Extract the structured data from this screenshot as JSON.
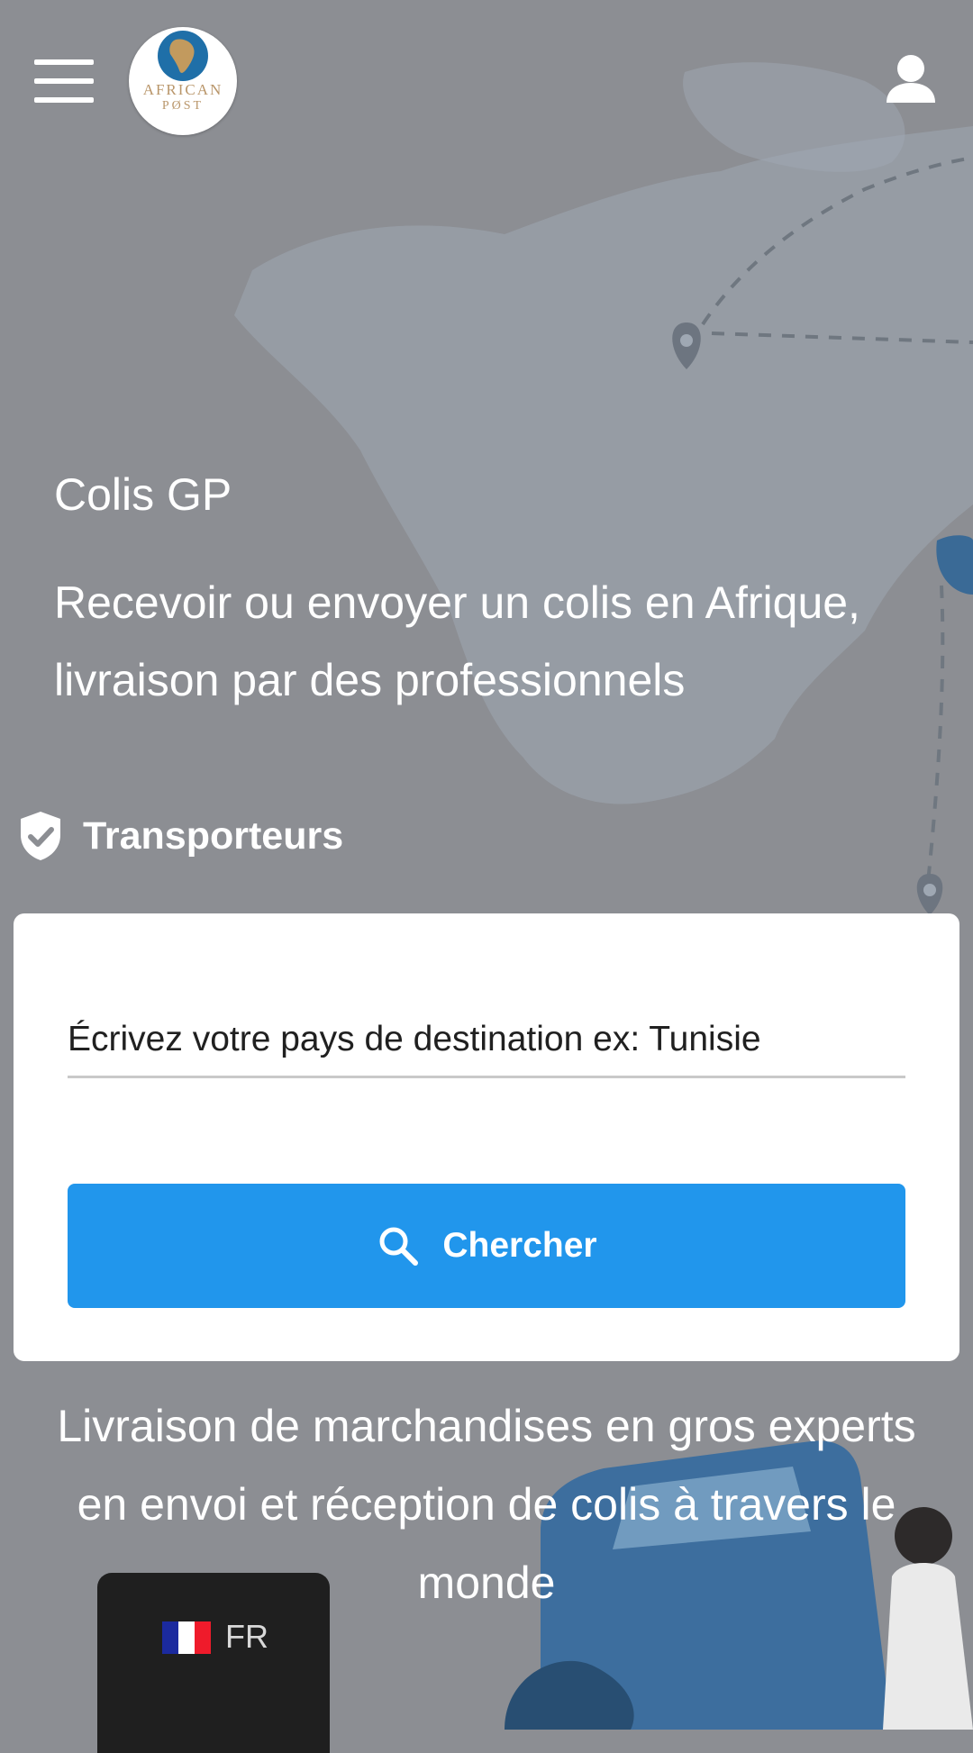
{
  "header": {
    "menu_icon": "hamburger-menu-icon",
    "logo_line1": "AFRICAN",
    "logo_line2": "PØST",
    "user_icon": "user-account-icon"
  },
  "hero": {
    "title": "Colis GP",
    "subtitle": "Recevoir ou envoyer un colis en Afrique, livraison par des professionnels"
  },
  "carriers": {
    "icon": "shield-check-icon",
    "label": "Transporteurs"
  },
  "search": {
    "placeholder": "Écrivez votre pays de destination ex: Tunisie",
    "value": "",
    "button_label": "Chercher",
    "button_icon": "search-icon"
  },
  "tagline": "Livraison de marchandises en gros experts en envoi et réception de colis à travers le monde",
  "language": {
    "code": "FR",
    "flag_icon": "france-flag-icon"
  },
  "colors": {
    "primary": "#2196ec",
    "overlay": "#8c8e93",
    "lang_bg": "#1f1f1f"
  }
}
